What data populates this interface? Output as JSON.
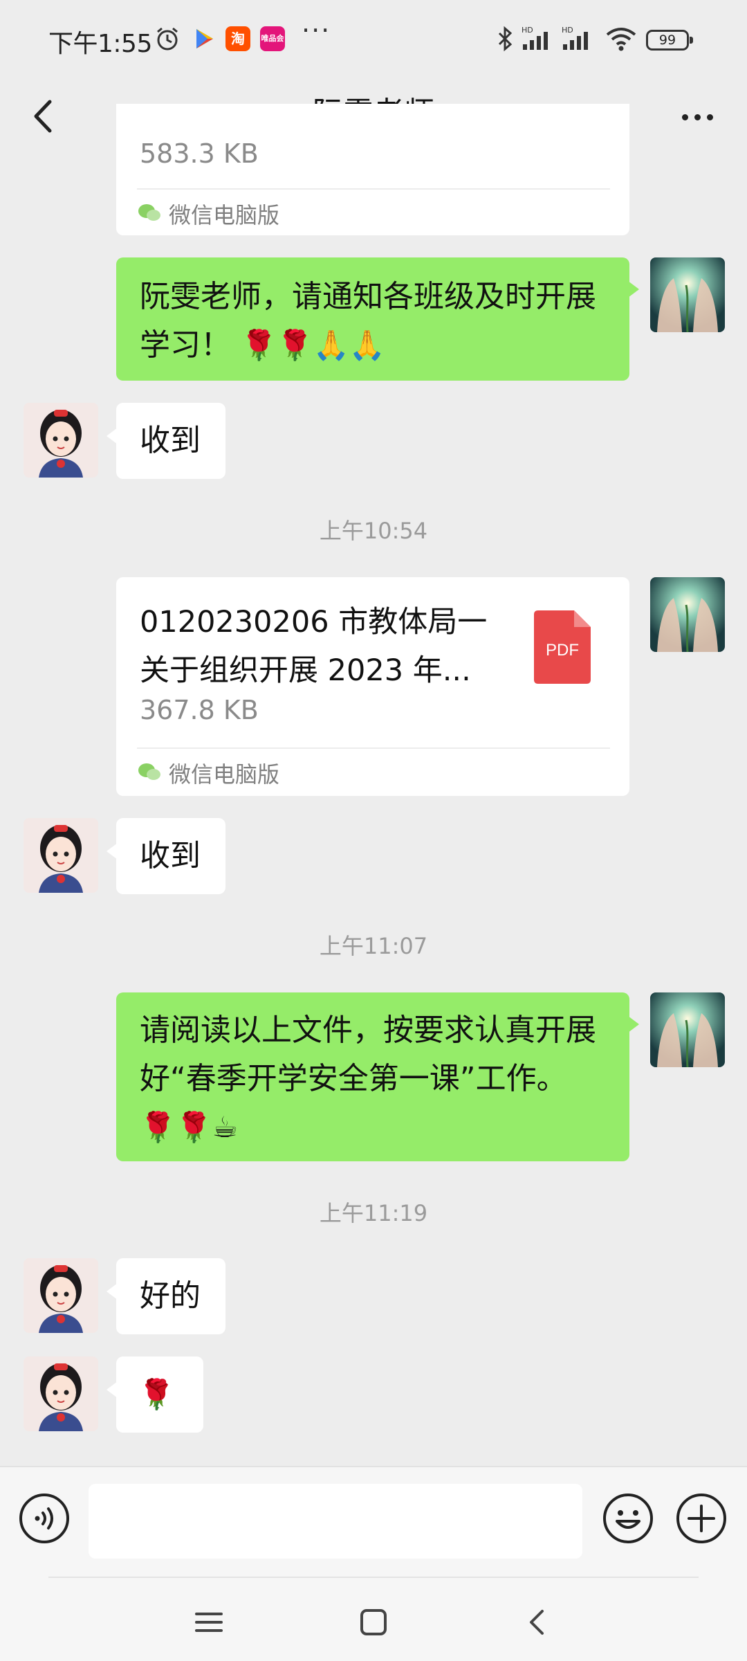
{
  "status_bar": {
    "time": "下午1:55",
    "battery": "99",
    "app_badges": [
      {
        "name": "taobao",
        "label": "淘",
        "color": "#ff5000"
      },
      {
        "name": "vipshop",
        "label": "唯品会",
        "color": "#e3157a"
      }
    ]
  },
  "header": {
    "title": "阮雯老师"
  },
  "messages": {
    "top_file": {
      "size": "583.3 KB",
      "source": "微信电脑版"
    },
    "msg1": {
      "line1": "阮雯老师，请通知各班级及时开展",
      "line2": "学习！",
      "emojis": "🌹🌹🙏🙏"
    },
    "msg2": {
      "text": "收到"
    },
    "time1": "上午10:54",
    "file2": {
      "name_line1": "0120230206 市教体局一",
      "name_line2": "关于组织开展 2023 年...",
      "size": "367.8 KB",
      "source": "微信电脑版",
      "type": "PDF"
    },
    "msg3": {
      "text": "收到"
    },
    "time2": "上午11:07",
    "msg4": {
      "line1": "请阅读以上文件，按要求认真开展",
      "line2": "好“春季开学安全第一课”工作。",
      "emojis": "🌹🌹☕"
    },
    "time3": "上午11:19",
    "msg5": {
      "text": "好的"
    },
    "msg6": {
      "emoji": "🌹"
    }
  },
  "input_bar": {
    "value": "",
    "placeholder": ""
  },
  "colors": {
    "background": "#ededed",
    "self_bubble": "#95ec69",
    "other_bubble": "#ffffff",
    "pdf": "#e8494a"
  }
}
